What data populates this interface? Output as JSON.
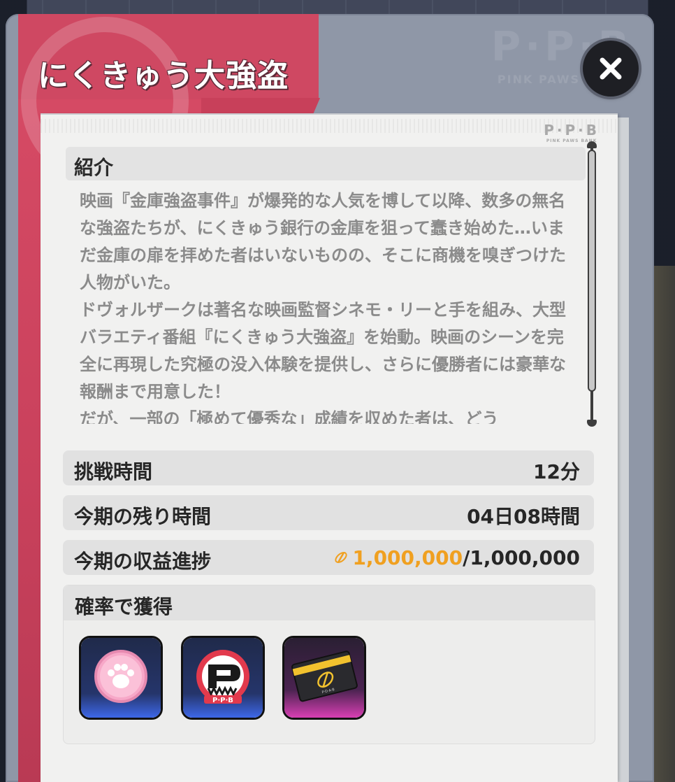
{
  "title": "にくきゅう大強盗",
  "close_icon": "close-icon",
  "watermark": {
    "logo": "P·P·B",
    "sub": "PINK PAWS BANK"
  },
  "paper_logo": {
    "main": "P·P·B",
    "sub": "PINK PAWS BANK"
  },
  "intro": {
    "header": "紹介",
    "text": "映画『金庫強盗事件』が爆発的な人気を博して以降、数多の無名な強盗たちが、にくきゅう銀行の金庫を狙って蠢き始めた…いまだ金庫の扉を拝めた者はいないものの、そこに商機を嗅ぎつけた人物がいた。\nドヴォルザークは著名な映画監督シネモ・リーと手を組み、大型バラエティ番組『にくきゅう大強盗』を始動。映画のシーンを完全に再現した究極の没入体験を提供し、さらに優勝者には豪華な報酬まで用意した！\nだが、一部の「極めて優秀な」成績を収めた者は、どう"
  },
  "info": {
    "challenge_time_label": "挑戦時間",
    "challenge_time_value": "12分",
    "remaining_label": "今期の残り時間",
    "remaining_value": "04日08時間",
    "progress_label": "今期の収益進捗",
    "progress_current": "1,000,000",
    "progress_total": "/1,000,000",
    "progress_fraction": 1.0
  },
  "rewards": {
    "header": "確率で獲得",
    "items": [
      {
        "icon": "paw-coin-icon",
        "rarity_color": "#3d67e8"
      },
      {
        "icon": "ppb-token-icon",
        "rarity_color": "#3d67e8"
      },
      {
        "icon": "vip-card-icon",
        "rarity_color": "#d83fb3"
      }
    ]
  },
  "colors": {
    "accent_gold": "#f0a020",
    "banner_pink": "#d84c66"
  }
}
